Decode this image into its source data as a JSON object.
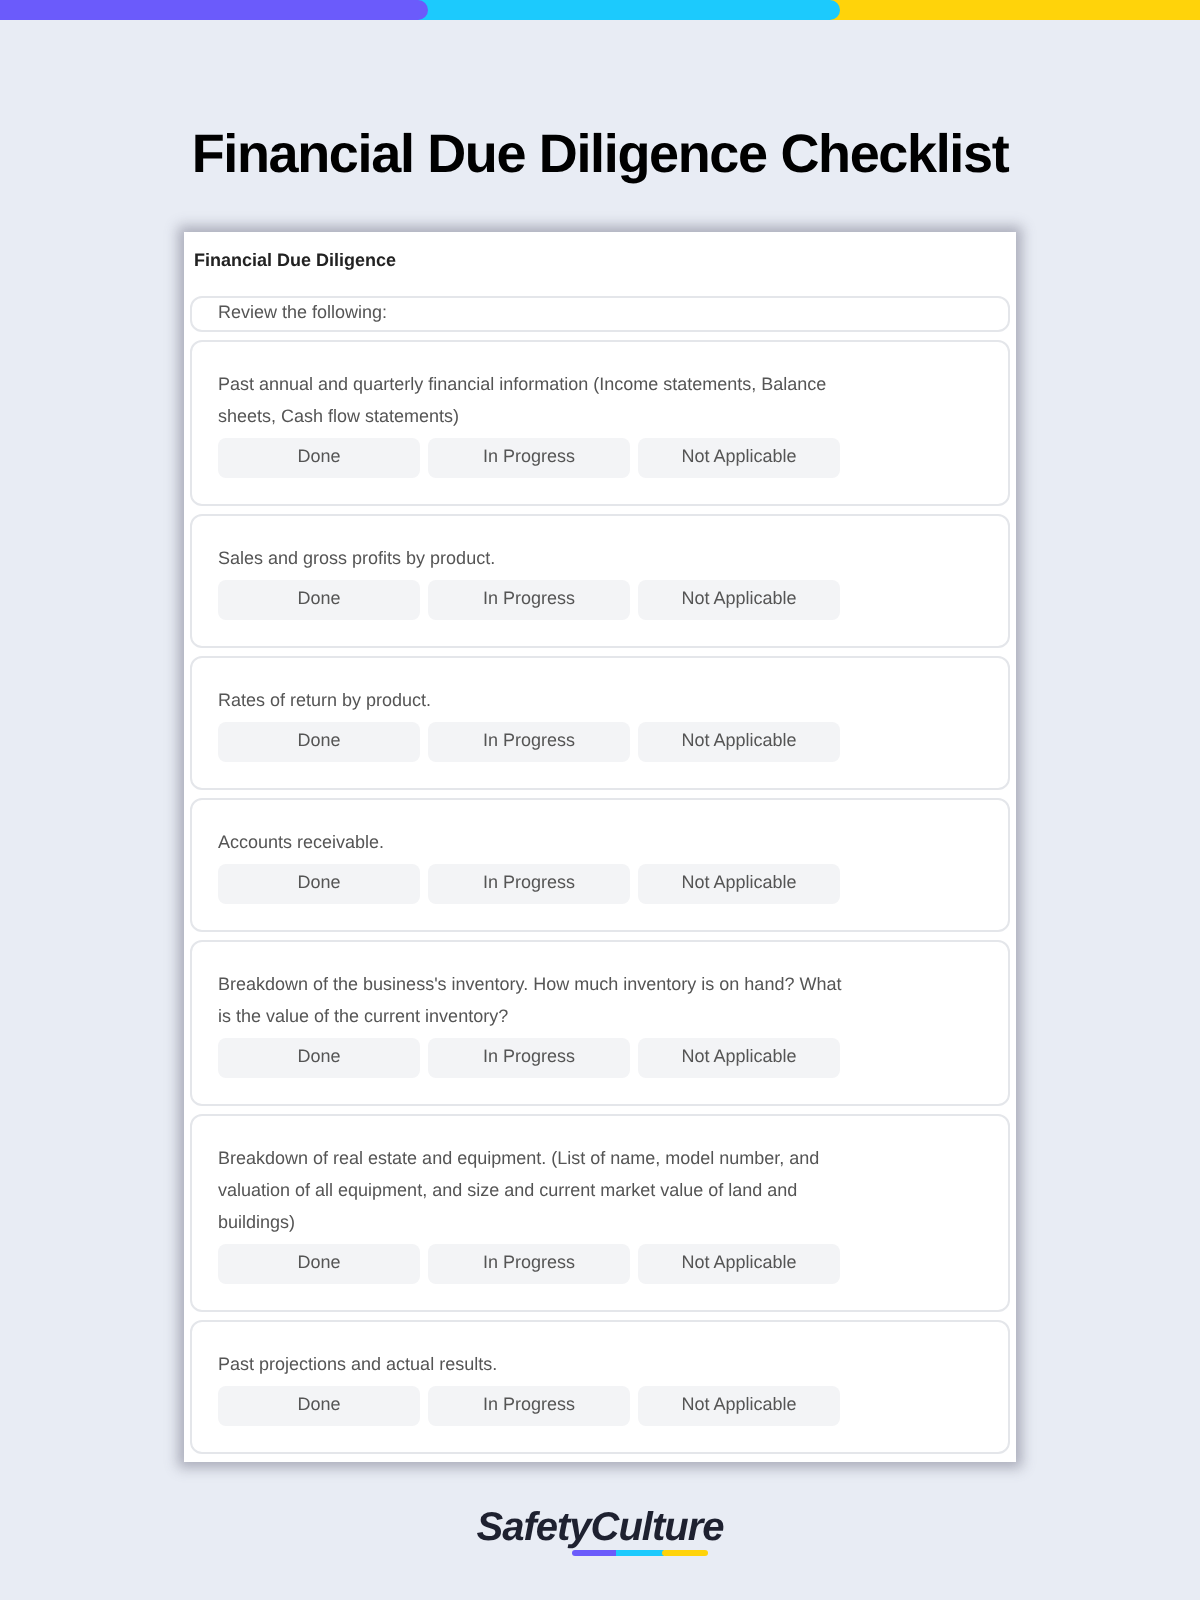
{
  "title": "Financial Due Diligence Checklist",
  "form": {
    "title": "Financial Due Diligence",
    "intro": "Review the following:",
    "items": [
      {
        "question": "Past annual and quarterly financial information (Income statements, Balance sheets, Cash flow statements)",
        "options": [
          "Done",
          "In Progress",
          "Not Applicable"
        ]
      },
      {
        "question": "Sales and gross profits by product.",
        "options": [
          "Done",
          "In Progress",
          "Not Applicable"
        ]
      },
      {
        "question": "Rates of return by product.",
        "options": [
          "Done",
          "In Progress",
          "Not Applicable"
        ]
      },
      {
        "question": "Accounts receivable.",
        "options": [
          "Done",
          "In Progress",
          "Not Applicable"
        ]
      },
      {
        "question": "Breakdown of the business's inventory. How much inventory is on hand? What is the value of the current inventory?",
        "options": [
          "Done",
          "In Progress",
          "Not Applicable"
        ]
      },
      {
        "question": "Breakdown of real estate and equipment. (List of name, model number, and valuation of all equipment, and size and current market value of land and buildings)",
        "options": [
          "Done",
          "In Progress",
          "Not Applicable"
        ]
      },
      {
        "question": "Past projections and actual results.",
        "options": [
          "Done",
          "In Progress",
          "Not Applicable"
        ]
      }
    ]
  },
  "logo": "SafetyCulture"
}
